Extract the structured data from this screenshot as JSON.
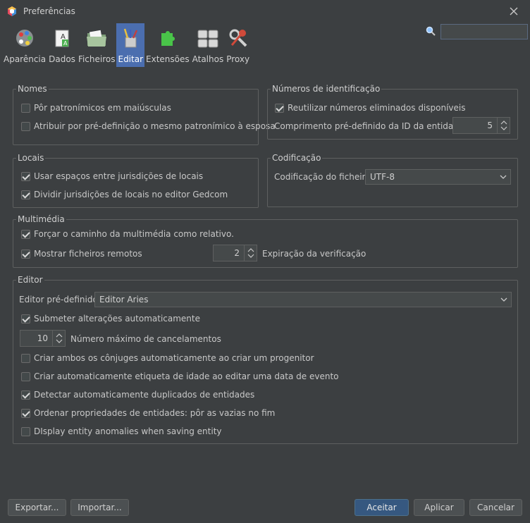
{
  "window": {
    "title": "Preferências"
  },
  "toolbar": {
    "items": [
      {
        "label": "Aparência",
        "icon": "appearance-icon"
      },
      {
        "label": "Dados",
        "icon": "data-icon"
      },
      {
        "label": "Ficheiros",
        "icon": "files-icon"
      },
      {
        "label": "Editar",
        "icon": "edit-icon",
        "active": true
      },
      {
        "label": "Extensões",
        "icon": "extensions-icon"
      },
      {
        "label": "Atalhos",
        "icon": "shortcuts-icon"
      },
      {
        "label": "Proxy",
        "icon": "proxy-icon"
      }
    ]
  },
  "search": {
    "value": ""
  },
  "nomes": {
    "title": "Nomes",
    "patronymic_upper": {
      "label": "Pôr patronímicos em maiúsculas",
      "checked": false
    },
    "patronymic_wife": {
      "label": "Atribuir por pré-definição o mesmo patronímico à esposa",
      "checked": false
    }
  },
  "numeros": {
    "title": "Números de identificação",
    "reuse": {
      "label": "Reutilizar números eliminados disponíveis",
      "checked": true
    },
    "id_length_label": "Comprimento pré-definido da ID da entidade:",
    "id_length_value": "5"
  },
  "locais": {
    "title": "Locais",
    "spaces": {
      "label": "Usar espaços entre jurisdições de locais",
      "checked": true
    },
    "split": {
      "label": "Dividir jurisdições de locais no editor Gedcom",
      "checked": true
    }
  },
  "codificacao": {
    "title": "Codificação",
    "file_label": "Codificação do ficheiro",
    "file_value": "UTF-8"
  },
  "multimedia": {
    "title": "Multimédia",
    "relative": {
      "label": "Forçar o caminho da multimédia como relativo.",
      "checked": true
    },
    "remote": {
      "label": "Mostrar ficheiros remotos",
      "checked": true
    },
    "expiry_value": "2",
    "expiry_label": "Expiração da verificação"
  },
  "editor": {
    "title": "Editor",
    "default_label": "Editor pré-definido",
    "default_value": "Editor Aries",
    "autocommit": {
      "label": "Submeter alterações automaticamente",
      "checked": true
    },
    "undo_value": "10",
    "undo_label": "Número máximo de cancelamentos",
    "spouses": {
      "label": "Criar ambos os cônjuges automaticamente ao criar um progenitor",
      "checked": false
    },
    "age_tag": {
      "label": "Criar automaticamente etiqueta de idade ao editar uma data de evento",
      "checked": false
    },
    "duplicates": {
      "label": "Detectar automaticamente duplicados de entidades",
      "checked": true
    },
    "sort_props": {
      "label": "Ordenar propriedades de entidades: pôr as vazias no fim",
      "checked": true
    },
    "anomalies": {
      "label": "DIsplay entity anomalies when saving entity",
      "checked": false
    }
  },
  "footer": {
    "export": "Exportar...",
    "import": "Importar...",
    "accept": "Aceitar",
    "apply": "Aplicar",
    "cancel": "Cancelar"
  },
  "colors": {
    "background": "#3c3f41",
    "accent": "#4b6eaf",
    "primary_button": "#365880"
  }
}
